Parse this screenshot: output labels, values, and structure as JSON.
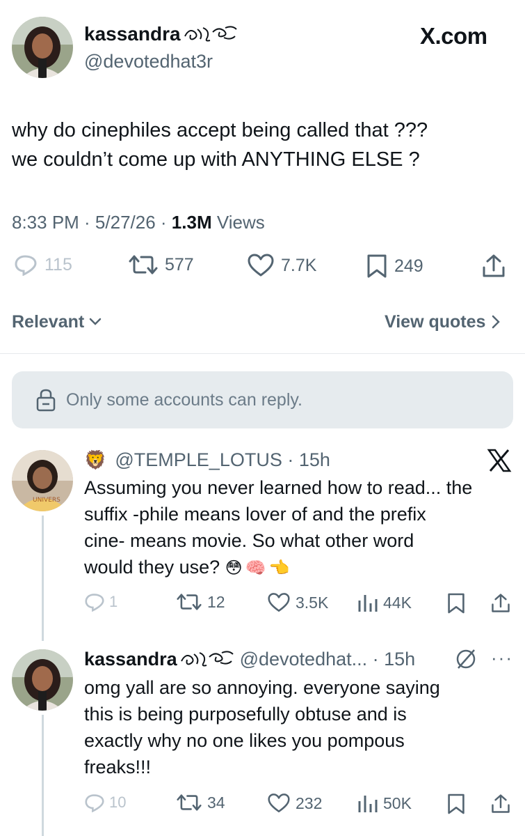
{
  "tweet": {
    "display_name": "kassandra",
    "handle": "@devotedhat3r",
    "site": "X.com",
    "text_line1": "why do cinephiles accept being called that ???",
    "text_line2": "we couldn’t come up with ANYTHING ELSE ?",
    "time": "8:33 PM · 5/27/26 · ",
    "views_count": "1.3M",
    "views_label": " Views",
    "stats": {
      "replies": "115",
      "retweets": "577",
      "likes": "7.7K",
      "bookmarks": "249"
    }
  },
  "sort": {
    "label": "Relevant",
    "view_quotes": "View quotes"
  },
  "notice": {
    "text": "Only some accounts can reply."
  },
  "replies": [
    {
      "emoji": "🦁",
      "handle": "@TEMPLE_LOTUS",
      "time": " · 15h",
      "lines": [
        "Assuming you never learned how to read... the",
        "suffix -phile means lover of and the prefix",
        "cine- means movie. So what other word",
        "would they use?"
      ],
      "emojis": "😳🧠👈",
      "stats": {
        "replies": "1",
        "retweets": "12",
        "likes": "3.5K",
        "views": "44K"
      }
    },
    {
      "display_name": "kassandra",
      "handle": "@devotedhat...",
      "time": " · 15h",
      "lines": [
        "omg yall are so annoying. everyone saying",
        "this is being purposefully obtuse and is",
        "exactly why no one likes you pompous",
        "freaks!!!"
      ],
      "stats": {
        "replies": "10",
        "retweets": "34",
        "likes": "232",
        "views": "50K"
      }
    }
  ],
  "colors": {
    "text": "#0f1419",
    "secondary": "#536471",
    "muted": "#b9c3cc",
    "notice_bg": "#e6ebee",
    "divider": "#e6e9ec"
  },
  "icons": [
    "reply-icon",
    "retweet-icon",
    "like-icon",
    "bookmark-icon",
    "share-icon",
    "views-icon",
    "lock-icon",
    "x-logo-icon",
    "chevron-down-icon",
    "chevron-right-icon",
    "no-reply-icon",
    "more-icon"
  ]
}
